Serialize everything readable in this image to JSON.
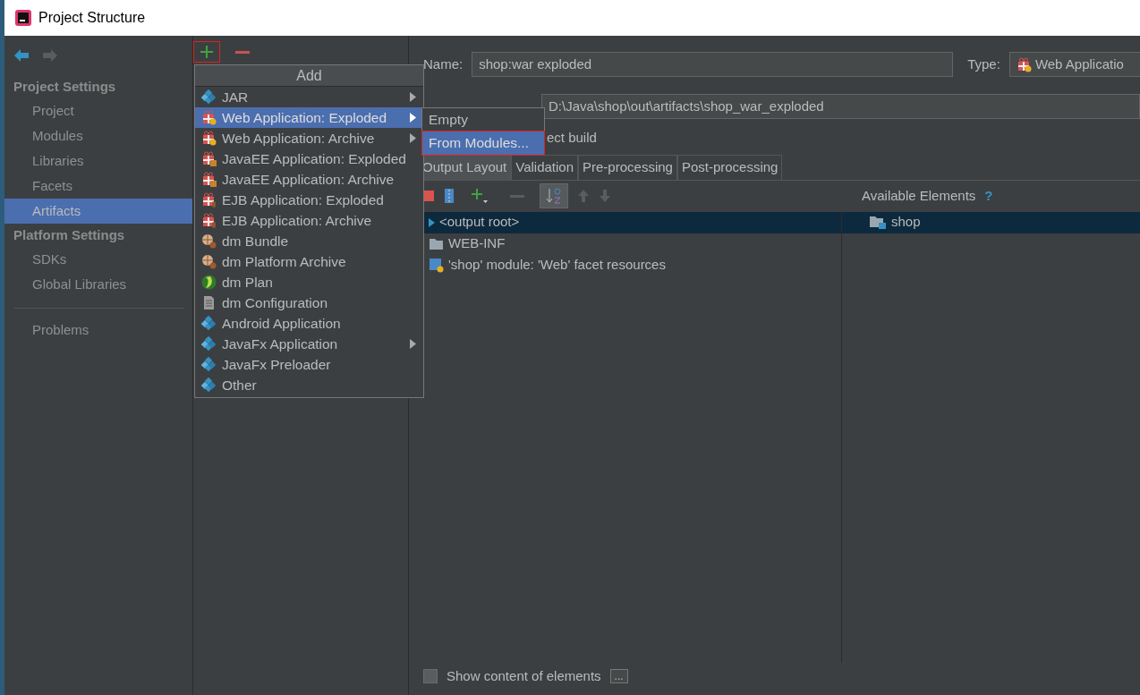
{
  "window": {
    "title": "Project Structure"
  },
  "sidebar": {
    "sections": [
      {
        "title": "Project Settings",
        "items": [
          {
            "label": "Project",
            "selected": false
          },
          {
            "label": "Modules",
            "selected": false
          },
          {
            "label": "Libraries",
            "selected": false
          },
          {
            "label": "Facets",
            "selected": false
          },
          {
            "label": "Artifacts",
            "selected": true
          }
        ]
      },
      {
        "title": "Platform Settings",
        "items": [
          {
            "label": "SDKs",
            "selected": false
          },
          {
            "label": "Global Libraries",
            "selected": false
          }
        ]
      },
      {
        "items": [
          {
            "label": "Problems",
            "selected": false
          }
        ]
      }
    ]
  },
  "artifact_toolbar": {
    "add_highlighted": true
  },
  "add_menu": {
    "title": "Add",
    "items": [
      {
        "label": "JAR",
        "kind": "jar",
        "submenu": true,
        "selected": false
      },
      {
        "label": "Web Application: Exploded",
        "kind": "web",
        "submenu": true,
        "selected": true
      },
      {
        "label": "Web Application: Archive",
        "kind": "web",
        "submenu": true,
        "selected": false
      },
      {
        "label": "JavaEE Application: Exploded",
        "kind": "javaee",
        "submenu": false,
        "selected": false
      },
      {
        "label": "JavaEE Application: Archive",
        "kind": "javaee",
        "submenu": false,
        "selected": false
      },
      {
        "label": "EJB Application: Exploded",
        "kind": "ejb",
        "submenu": false,
        "selected": false
      },
      {
        "label": "EJB Application: Archive",
        "kind": "ejb",
        "submenu": false,
        "selected": false
      },
      {
        "label": "dm Bundle",
        "kind": "bundle",
        "submenu": false,
        "selected": false
      },
      {
        "label": "dm Platform Archive",
        "kind": "bundle",
        "submenu": false,
        "selected": false
      },
      {
        "label": "dm Plan",
        "kind": "plan",
        "submenu": false,
        "selected": false
      },
      {
        "label": "dm Configuration",
        "kind": "config",
        "submenu": false,
        "selected": false
      },
      {
        "label": "Android Application",
        "kind": "jar",
        "submenu": false,
        "selected": false
      },
      {
        "label": "JavaFx Application",
        "kind": "jar",
        "submenu": true,
        "selected": false
      },
      {
        "label": "JavaFx Preloader",
        "kind": "jar",
        "submenu": false,
        "selected": false
      },
      {
        "label": "Other",
        "kind": "jar",
        "submenu": false,
        "selected": false
      }
    ]
  },
  "submenu": {
    "items": [
      {
        "label": "Empty",
        "selected": false,
        "highlighted": false
      },
      {
        "label": "From Modules...",
        "selected": true,
        "highlighted": true
      }
    ]
  },
  "form": {
    "name_label": "Name:",
    "name_value": "shop:war exploded",
    "type_label": "Type:",
    "type_value": "Web Applicatio",
    "output_value": "D:\\Java\\shop\\out\\artifacts\\shop_war_exploded",
    "build_label": "ect build"
  },
  "tabs": [
    {
      "label": "Output Layout",
      "selected": true
    },
    {
      "label": "Validation",
      "selected": false
    },
    {
      "label": "Pre-processing",
      "selected": false
    },
    {
      "label": "Post-processing",
      "selected": false
    }
  ],
  "layout": {
    "available_title": "Available Elements",
    "help": "?",
    "tree": [
      {
        "label": "<output root>",
        "kind": "root",
        "selected": true
      },
      {
        "label": "WEB-INF",
        "kind": "folder",
        "selected": false
      },
      {
        "label": "'shop' module: 'Web' facet resources",
        "kind": "facet",
        "selected": false
      }
    ],
    "available": [
      {
        "label": "shop",
        "kind": "module"
      }
    ]
  },
  "show_content": {
    "label": "Show content of elements",
    "checked": false,
    "more": "..."
  }
}
